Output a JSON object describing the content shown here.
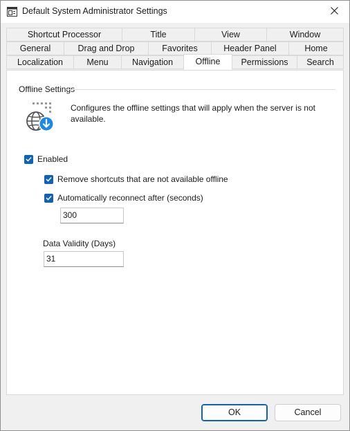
{
  "window": {
    "title": "Default System Administrator Settings"
  },
  "icons": {
    "app": "settings-window-icon",
    "close": "close-icon",
    "hero": "globe-download-icon",
    "check": "checkmark-icon"
  },
  "tabs": {
    "row1": [
      "Shortcut Processor",
      "Title",
      "View",
      "Window"
    ],
    "row2": [
      "General",
      "Drag and Drop",
      "Favorites",
      "Header Panel",
      "Home"
    ],
    "row3": [
      "Localization",
      "Menu",
      "Navigation",
      "Offline",
      "Permissions",
      "Search"
    ],
    "selected": "Offline"
  },
  "offline": {
    "group_title": "Offline Settings",
    "description": "Configures the offline settings that will apply when the server is not available.",
    "enabled_label": "Enabled",
    "enabled": true,
    "remove_shortcuts_label": "Remove shortcuts that are not available offline",
    "remove_shortcuts": true,
    "auto_reconnect_label": "Automatically reconnect after (seconds)",
    "auto_reconnect": true,
    "reconnect_seconds": "300",
    "validity_label": "Data Validity (Days)",
    "validity_days": "31"
  },
  "buttons": {
    "ok": "OK",
    "cancel": "Cancel"
  },
  "colors": {
    "accent": "#0f62b8",
    "dialog_bg": "#f0f0f0",
    "panel_bg": "#ffffff"
  }
}
